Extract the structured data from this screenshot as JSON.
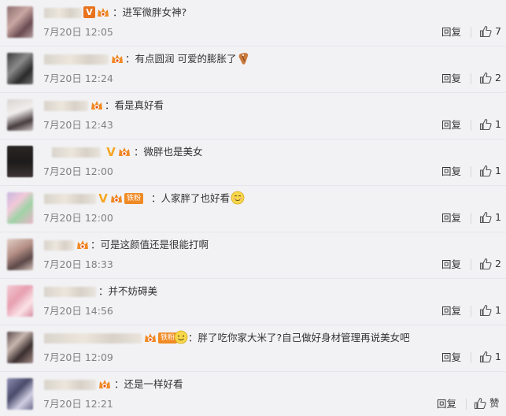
{
  "reply_label": "回复",
  "like_label": "赞",
  "comments": [
    {
      "text": "：进军微胖女神?",
      "time": "7月20日 12:05",
      "likes": "7"
    },
    {
      "text": "：有点圆润 可爱的膨胀了",
      "time": "7月20日 12:24",
      "likes": "2"
    },
    {
      "text": "：看是真好看",
      "time": "7月20日 12:43",
      "likes": "1"
    },
    {
      "text": "：微胖也是美女",
      "time": "7月20日 12:00",
      "likes": "1"
    },
    {
      "text": "：人家胖了也好看",
      "time": "7月20日 12:00",
      "likes": "1"
    },
    {
      "text": "：可是这颜值还是很能打啊",
      "time": "7月20日 18:33",
      "likes": "2"
    },
    {
      "text": "：并不妨碍美",
      "time": "7月20日 14:56",
      "likes": "1"
    },
    {
      "text": "：胖了吃你家大米了?自己做好身材管理再说美女吧",
      "time": "7月20日 12:09",
      "likes": "1"
    },
    {
      "text": "：还是一样好看",
      "time": "7月20日 12:21",
      "likes": ""
    }
  ],
  "fan_badge_label": "铁粉",
  "icons": {
    "like": "thumbs-up-icon",
    "vip": "orange-v-icon",
    "crown": "vip-crown-icon",
    "emoji_smile": "smile-emoji-icon",
    "emoji_bread": "bread-emoji-icon"
  },
  "colors": {
    "background": "#f2f2f5",
    "text": "#333333",
    "time": "#808080",
    "vip_orange": "#e8731c",
    "crown_orange": "#f08a24"
  }
}
